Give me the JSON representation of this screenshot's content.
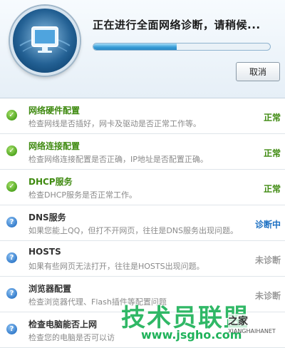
{
  "header": {
    "title": "正在进行全面网络诊断，请稍候...",
    "progress": 0.47,
    "cancel_label": "取消"
  },
  "items": [
    {
      "title": "网络硬件配置",
      "desc": "检查网线是否插好，网卡及驱动是否正常工作等。",
      "status": "正常",
      "state": "ok"
    },
    {
      "title": "网络连接配置",
      "desc": "检查网络连接配置是否正确，IP地址是否配置正确。",
      "status": "正常",
      "state": "ok"
    },
    {
      "title": "DHCP服务",
      "desc": "检查DHCP服务是否正常工作。",
      "status": "正常",
      "state": "ok"
    },
    {
      "title": "DNS服务",
      "desc": "如果您能上QQ，但打不开网页，往往是DNS服务出现问题。",
      "status": "诊断中",
      "state": "active"
    },
    {
      "title": "HOSTS",
      "desc": "如果有些网页无法打开，往往是HOSTS出现问题。",
      "status": "未诊断",
      "state": "pending"
    },
    {
      "title": "浏览器配置",
      "desc": "检查浏览器代理、Flash插件等配置问题",
      "status": "未诊断",
      "state": "pending"
    },
    {
      "title": "检查电脑能否上网",
      "desc": "检查您的电脑是否可以访",
      "status": "",
      "state": "pending"
    }
  ],
  "watermark": {
    "main": "技术员联盟",
    "side": "之家",
    "url": "www.jsgho.com",
    "en": "XIANGHAIHANET"
  },
  "colors": {
    "ok": "#3f8a10",
    "active": "#1b6fc2",
    "pending": "#9a9a9a",
    "watermark": "#1fb25a"
  }
}
